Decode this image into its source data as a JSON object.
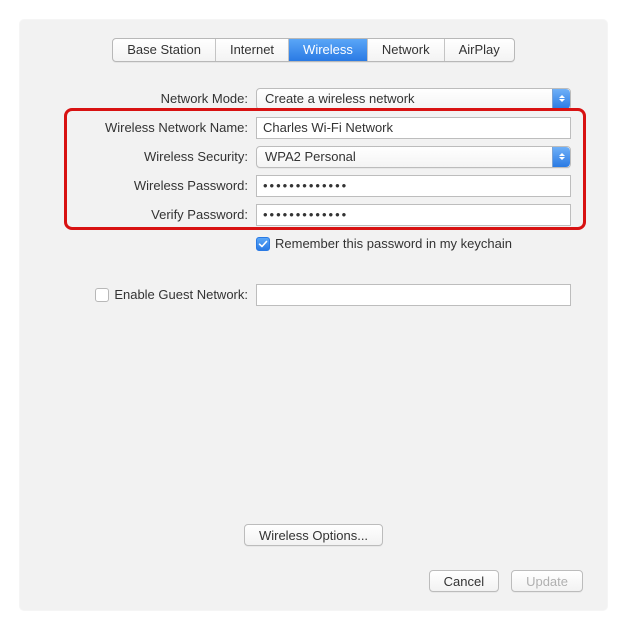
{
  "tabs": {
    "base_station": "Base Station",
    "internet": "Internet",
    "wireless": "Wireless",
    "network": "Network",
    "airplay": "AirPlay"
  },
  "form": {
    "network_mode_label": "Network Mode:",
    "network_mode_value": "Create a wireless network",
    "network_name_label": "Wireless Network Name:",
    "network_name_value": "Charles Wi-Fi Network",
    "security_label": "Wireless Security:",
    "security_value": "WPA2 Personal",
    "password_label": "Wireless Password:",
    "password_value": "•••••••••••••",
    "verify_label": "Verify Password:",
    "verify_value": "•••••••••••••",
    "remember_label": "Remember this password in my keychain",
    "guest_label": "Enable Guest Network:"
  },
  "buttons": {
    "wireless_options": "Wireless Options...",
    "cancel": "Cancel",
    "update": "Update"
  }
}
